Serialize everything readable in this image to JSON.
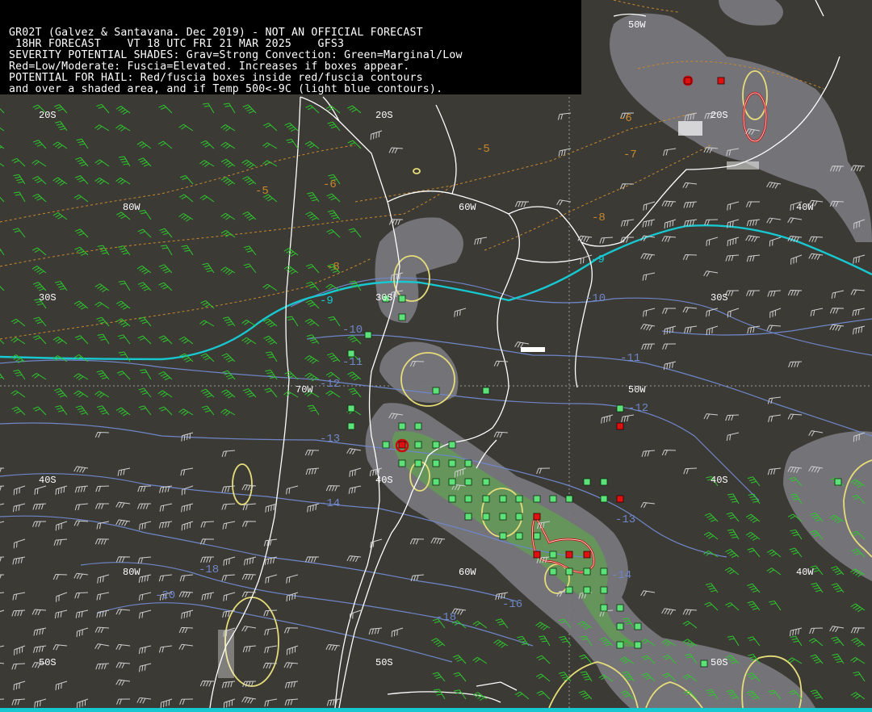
{
  "header": {
    "line1": "GR02T (Galvez & Santavana. Dec 2019) - NOT AN OFFICIAL FORECAST",
    "line2": " 18HR FORECAST    VT 18 UTC FRI 21 MAR 2025    GFS3",
    "line3": "SEVERITY POTENTIAL SHADES: Grav=Strong Convection: Green=Marginal/Low",
    "line4": "Red=Low/Moderate: Fuscia=Elevated. Increases if boxes appear.",
    "line5": "POTENTIAL FOR HAIL: Red/fuscia boxes inside red/fuscia contours",
    "line6": "and over a shaded area, and if Temp 500<-9C (light blue contours)."
  },
  "grid_labels": {
    "lat_20s": "20S",
    "lat_30s": "30S",
    "lat_40s": "40S",
    "lat_50s": "50S",
    "lon_80w": "80W",
    "lon_70w": "70W",
    "lon_60w": "60W",
    "lon_50w": "50W",
    "lon_40w": "40W"
  },
  "temp_labels": {
    "t_m5": "-5",
    "t_m6": "-6",
    "t_m7": "-7",
    "t_m8": "-8",
    "t_m9": "-9",
    "t_m10": "-10",
    "t_m11": "-11",
    "t_m12": "-12",
    "t_m13": "-13",
    "t_m14": "-14",
    "t_m16": "-16",
    "t_m18": "-18",
    "t_m20": "-20"
  },
  "colors": {
    "background": "#3b3a35",
    "coastline": "#ffffff",
    "temp_9c_contour": "#18c8d0",
    "temp_contours": "#6f86c8",
    "low_level_temp": "#c9882c",
    "marginal_box": "#5de27a",
    "moderate_box": "#e01010",
    "convection_shade": "#7a7a80",
    "hail_contour": "#e6dc7a",
    "wind_barbs_green": "#2ec82e",
    "wind_barbs_white": "#cfcfcf"
  }
}
